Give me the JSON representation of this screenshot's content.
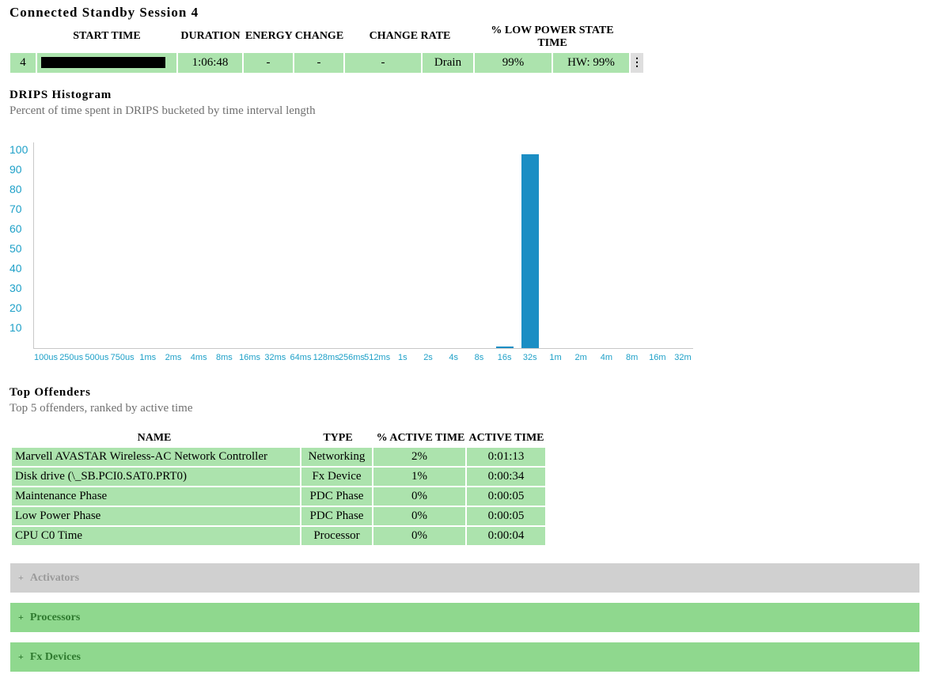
{
  "session": {
    "title": "Connected Standby Session 4",
    "headers": {
      "start_time": "START TIME",
      "duration": "DURATION",
      "energy_change": "ENERGY CHANGE",
      "change_rate": "CHANGE RATE",
      "low_power_line1": "% LOW POWER STATE",
      "low_power_line2": "TIME"
    },
    "row": {
      "index": "4",
      "start_time": "",
      "duration": "1:06:48",
      "energy_change_a": "-",
      "energy_change_b": "-",
      "change_rate": "-",
      "state": "Drain",
      "low_power": "99%",
      "hw": "HW: 99%"
    },
    "menu_glyph": "⋮"
  },
  "drips": {
    "title": "DRIPS Histogram",
    "subtitle": "Percent of time spent in DRIPS bucketed by time interval length"
  },
  "chart_data": {
    "type": "bar",
    "categories": [
      "100us",
      "250us",
      "500us",
      "750us",
      "1ms",
      "2ms",
      "4ms",
      "8ms",
      "16ms",
      "32ms",
      "64ms",
      "128ms",
      "256ms",
      "512ms",
      "1s",
      "2s",
      "4s",
      "8s",
      "16s",
      "32s",
      "1m",
      "2m",
      "4m",
      "8m",
      "16m",
      "32m"
    ],
    "values": [
      0,
      0,
      0,
      0,
      0,
      0,
      0,
      0,
      0,
      0,
      0,
      0,
      0,
      0,
      0,
      0,
      0,
      0,
      1,
      98,
      0,
      0,
      0,
      0,
      0,
      0
    ],
    "y_ticks": [
      "10",
      "20",
      "30",
      "40",
      "50",
      "60",
      "70",
      "80",
      "90",
      "100"
    ],
    "ylim": [
      0,
      100
    ],
    "bar_color": "#1b8ec4",
    "tick_color": "#1ea0c8"
  },
  "offenders": {
    "title": "Top Offenders",
    "subtitle": "Top 5 offenders, ranked by active time",
    "headers": {
      "name": "NAME",
      "type": "TYPE",
      "pct": "% ACTIVE TIME",
      "active": "ACTIVE TIME"
    },
    "rows": [
      {
        "name": "Marvell AVASTAR Wireless-AC Network Controller",
        "type": "Networking",
        "pct": "2%",
        "active": "0:01:13"
      },
      {
        "name": "Disk drive (\\_SB.PCI0.SAT0.PRT0)",
        "type": "Fx Device",
        "pct": "1%",
        "active": "0:00:34"
      },
      {
        "name": "Maintenance Phase",
        "type": "PDC Phase",
        "pct": "0%",
        "active": "0:00:05"
      },
      {
        "name": "Low Power Phase",
        "type": "PDC Phase",
        "pct": "0%",
        "active": "0:00:05"
      },
      {
        "name": "CPU C0 Time",
        "type": "Processor",
        "pct": "0%",
        "active": "0:00:04"
      }
    ]
  },
  "sections": {
    "plus": "+",
    "activators": "Activators",
    "processors": "Processors",
    "fx_devices": "Fx Devices"
  },
  "colors": {
    "row_green": "#ace3ad",
    "section_green": "#8fd88e",
    "section_gray": "#d0d0d0"
  }
}
